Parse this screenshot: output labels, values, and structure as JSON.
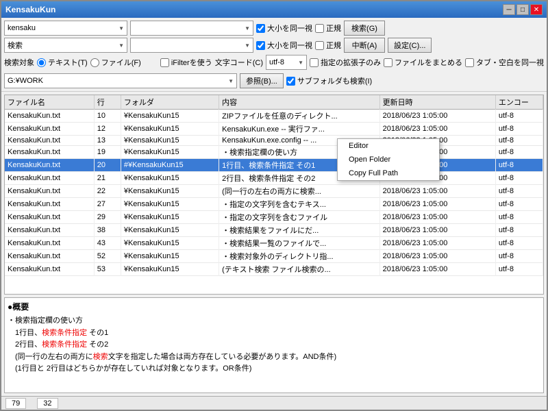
{
  "window": {
    "title": "KensakuKun",
    "controls": [
      "minimize",
      "maximize",
      "close"
    ]
  },
  "toolbar": {
    "search1_value": "kensaku",
    "search2_value": "検索",
    "dropdown1_placeholder": "",
    "dropdown2_placeholder": "",
    "checkbox_case1": "大小を同一視",
    "checkbox_regex1": "正規",
    "checkbox_case2": "大小を同一視",
    "checkbox_regex2": "正規",
    "btn_search": "検索(G)",
    "btn_stop": "中断(A)",
    "btn_settings": "設定(C)...",
    "label_target": "検索対象",
    "radio_text": "テキスト(T)",
    "radio_file": "ファイル(F)",
    "checkbox_ifilter": "iFilterを使う",
    "label_encoding": "文字コード(C)",
    "encoding_value": "utf-8",
    "checkbox_ext_only": "指定の拡張子のみ",
    "checkbox_merge": "ファイルをまとめる",
    "checkbox_tab": "タブ・空白を同一視",
    "path_value": "G:¥WORK",
    "btn_browse": "参照(B)...",
    "checkbox_subfolders": "サブフォルダも検索(I)"
  },
  "table": {
    "headers": [
      "ファイル名",
      "行",
      "フォルダ",
      "内容",
      "更新日時",
      "エンコー"
    ],
    "rows": [
      {
        "filename": "KensakuKun.txt",
        "line": "10",
        "folder": "¥KensakuKun15",
        "content": "ZIPファイルを任意のディレクト...",
        "date": "2018/06/23 1:05:00",
        "enc": "utf-8"
      },
      {
        "filename": "KensakuKun.txt",
        "line": "12",
        "folder": "¥KensakuKun15",
        "content": "KensakuKun.exe -- 実行ファ...",
        "date": "2018/06/23 1:05:00",
        "enc": "utf-8"
      },
      {
        "filename": "KensakuKun.txt",
        "line": "13",
        "folder": "¥KensakuKun15",
        "content": "KensakuKun.exe.config -- ...",
        "date": "2018/06/23 1:05:00",
        "enc": "utf-8"
      },
      {
        "filename": "KensakuKun.txt",
        "line": "19",
        "folder": "¥KensakuKun15",
        "content": "・検索指定欄の使い方",
        "date": "2018/06/23 1:05:00",
        "enc": "utf-8"
      },
      {
        "filename": "KensakuKun.txt",
        "line": "20",
        "folder": "#¥KensakuKun15",
        "content": "1行目、検索条件指定 その1",
        "date": "2018/06/23 1:05:00",
        "enc": "utf-8",
        "selected": true
      },
      {
        "filename": "KensakuKun.txt",
        "line": "21",
        "folder": "¥KensakuKun15",
        "content": "2行目、検索条件指定 その2",
        "date": "2018/06/23 1:05:00",
        "enc": "utf-8"
      },
      {
        "filename": "KensakuKun.txt",
        "line": "22",
        "folder": "¥KensakuKun15",
        "content": "(同一行の左右の両方に検索...",
        "date": "2018/06/23 1:05:00",
        "enc": "utf-8"
      },
      {
        "filename": "KensakuKun.txt",
        "line": "27",
        "folder": "¥KensakuKun15",
        "content": "・指定の文字列を含むテキス...",
        "date": "2018/06/23 1:05:00",
        "enc": "utf-8"
      },
      {
        "filename": "KensakuKun.txt",
        "line": "29",
        "folder": "¥KensakuKun15",
        "content": "・指定の文字列を含むファイル",
        "date": "2018/06/23 1:05:00",
        "enc": "utf-8"
      },
      {
        "filename": "KensakuKun.txt",
        "line": "38",
        "folder": "¥KensakuKun15",
        "content": "・検索結果をファイルにだ...",
        "date": "2018/06/23 1:05:00",
        "enc": "utf-8"
      },
      {
        "filename": "KensakuKun.txt",
        "line": "43",
        "folder": "¥KensakuKun15",
        "content": "・検索結果一覧のファイルで...",
        "date": "2018/06/23 1:05:00",
        "enc": "utf-8"
      },
      {
        "filename": "KensakuKun.txt",
        "line": "52",
        "folder": "¥KensakuKun15",
        "content": "・検索対象外のディレクトリ指...",
        "date": "2018/06/23 1:05:00",
        "enc": "utf-8"
      },
      {
        "filename": "KensakuKun.txt",
        "line": "53",
        "folder": "¥KensakuKun15",
        "content": "(テキスト検索 ファイル検索の...",
        "date": "2018/06/23 1:05:00",
        "enc": "utf-8"
      }
    ]
  },
  "context_menu": {
    "items": [
      "Editor",
      "Open Folder",
      "Copy Full Path"
    ]
  },
  "summary": {
    "title": "●概要",
    "lines": [
      {
        "text": "・検索指定欄の使い方",
        "highlight": false
      },
      {
        "text": "　1行目、",
        "highlight": false
      },
      {
        "text": "検索条件指定",
        "highlight": true
      },
      {
        "text": " その1",
        "highlight": false
      },
      {
        "text": "　2行目、",
        "highlight": false
      },
      {
        "text": "検索条件指定",
        "highlight": true
      },
      {
        "text": " その2",
        "highlight": false
      },
      {
        "text": "　(同一行の左右の両方に",
        "highlight": false
      },
      {
        "text": "検索",
        "highlight": true
      },
      {
        "text": "文字を指定した場合は両方存在している必要があります。AND条件)",
        "highlight": false
      },
      {
        "text": "　(1行目と 2行目はどちらかが存在していれば対象となります。OR条件)",
        "highlight": false
      }
    ]
  },
  "statusbar": {
    "row": "79",
    "col": "32"
  }
}
